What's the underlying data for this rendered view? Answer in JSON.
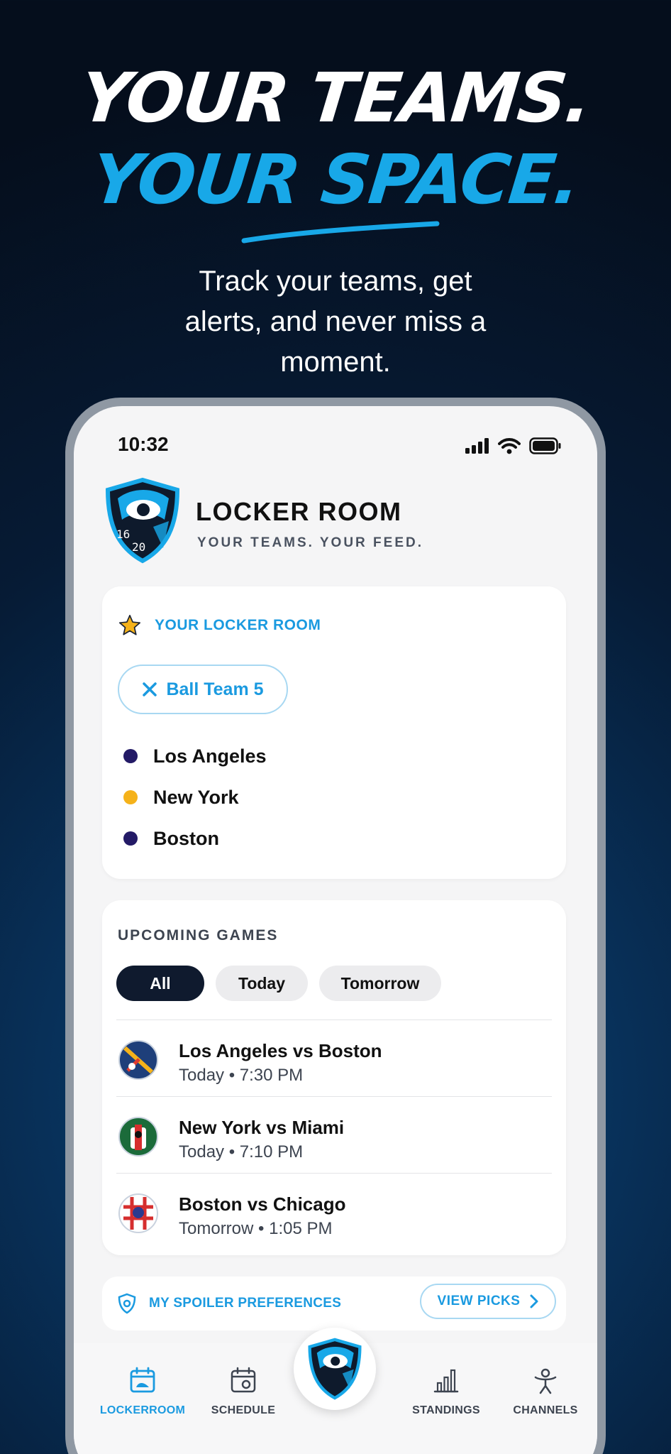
{
  "hero": {
    "line1": "YOUR TEAMS.",
    "line2": "YOUR SPACE.",
    "subtitle": "Track your teams, get alerts, and never miss a moment."
  },
  "status_bar": {
    "time": "10:32"
  },
  "app": {
    "title": "LOCKER ROOM",
    "tagline": "YOUR TEAMS. YOUR FEED."
  },
  "locker": {
    "heading": "YOUR LOCKER ROOM",
    "chip_label": "Ball Team 5",
    "teams": [
      {
        "name": "Los Angeles",
        "color": "#231a66"
      },
      {
        "name": "New York",
        "color": "#f5b21a"
      },
      {
        "name": "Boston",
        "color": "#231a66"
      }
    ]
  },
  "games": {
    "heading": "UPCOMING GAMES",
    "filters": [
      "All",
      "Today",
      "Tomorrow"
    ],
    "selected_filter": "All",
    "items": [
      {
        "title": "Los Angeles vs Boston",
        "when": "Today • 7:30 PM"
      },
      {
        "title": "New York vs Miami",
        "when": "Today • 7:10 PM"
      },
      {
        "title": "Boston vs Chicago",
        "when": "Tomorrow • 1:05 PM"
      }
    ]
  },
  "spoiler": {
    "label": "MY SPOILER PREFERENCES",
    "button": "VIEW PICKS"
  },
  "tabs": [
    {
      "label": "LOCKERROOM",
      "icon": "locker-calendar-icon",
      "active": true
    },
    {
      "label": "SCHEDULE",
      "icon": "calendar-icon",
      "active": false
    },
    {
      "label": "STANDINGS",
      "icon": "bar-chart-icon",
      "active": false
    },
    {
      "label": "CHANNELS",
      "icon": "person-icon",
      "active": false
    }
  ],
  "colors": {
    "accent": "#1a9ae0",
    "dark": "#0f1a2e",
    "headline_blue": "#18a8e8"
  }
}
